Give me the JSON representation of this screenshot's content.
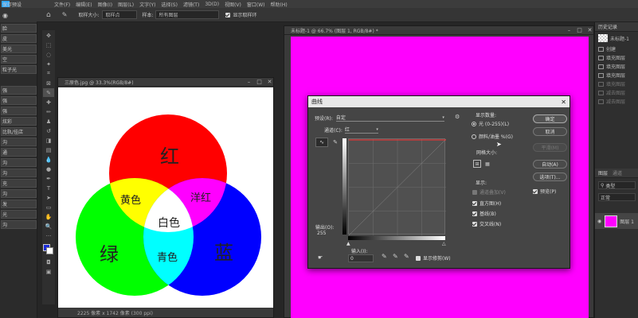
{
  "menubar": {
    "items": [
      "文件(F)",
      "编辑(E)",
      "图像(I)",
      "图层(L)",
      "文字(Y)",
      "选择(S)",
      "滤镜(T)",
      "3D(D)",
      "视图(V)",
      "窗口(W)",
      "帮助(H)"
    ]
  },
  "optbar": {
    "sample_size_label": "取样大小:",
    "sample_size_value": "取样点",
    "sample_layers_value": "所有图层",
    "show_ring_label": "显示取样环"
  },
  "leftstrip": {
    "top_label": "保存预设",
    "items": [
      "脸",
      "皮",
      "美光",
      "空",
      "粒子光",
      "",
      "强",
      "强",
      "强",
      "炫彩",
      "比轨/挂店",
      "沟",
      "通",
      "沟",
      "沟",
      "充",
      "沟",
      "发",
      "光",
      "沟"
    ]
  },
  "doc1": {
    "title": "三原色.jpg @ 33.3%(RGB/8#)",
    "status": "2225 像素 x 1742 像素 (300 ppi)",
    "circles": {
      "red": "红",
      "green": "绿",
      "blue": "蓝",
      "yellow": "黄色",
      "magenta": "洋红",
      "cyan": "青色",
      "white": "白色"
    }
  },
  "doc2": {
    "title": "未标题-1 @ 66.7% (图层 1, RGB/8#) *"
  },
  "curves": {
    "title": "曲线",
    "preset_label": "预设(R):",
    "preset_value": "自定",
    "channel_label": "通道(C):",
    "channel_value": "红",
    "output_label": "输出(O):",
    "output_value": "255",
    "input_label": "输入(I):",
    "input_value": "0",
    "show_clipping": "显示修剪(W)",
    "display_amount_heading": "显示数量:",
    "radio_light": "光 (0-255)(L)",
    "radio_pigment": "颜料/油墨 %(G)",
    "grid_size_label": "网格大小:",
    "show_heading": "显示:",
    "chk_channel_overlay": "通道叠加(V)",
    "chk_histogram": "直方图(H)",
    "chk_baseline": "基线(B)",
    "chk_intersection": "交叉线(N)",
    "btn_ok": "确定",
    "btn_cancel": "取消",
    "btn_smooth": "平滑(M)",
    "btn_auto": "自动(A)",
    "btn_options": "选项(T)...",
    "chk_preview": "预览(P)"
  },
  "history": {
    "panel_title": "历史记录",
    "snapshot": "未标题-1",
    "rows": [
      "创建",
      "填充图层",
      "填充图层",
      "填充图层"
    ],
    "dim_rows": [
      "填充图层",
      "减去图层",
      "减去图层"
    ]
  },
  "layers": {
    "tabs": [
      "图层",
      "通道"
    ],
    "kind_label": "类型",
    "blend_mode": "正常",
    "layer_name": "图层 1"
  },
  "colors": {
    "magenta_canvas": "#ff00ff",
    "red": "#ff0000",
    "green": "#00ff00",
    "blue": "#0000ff"
  }
}
